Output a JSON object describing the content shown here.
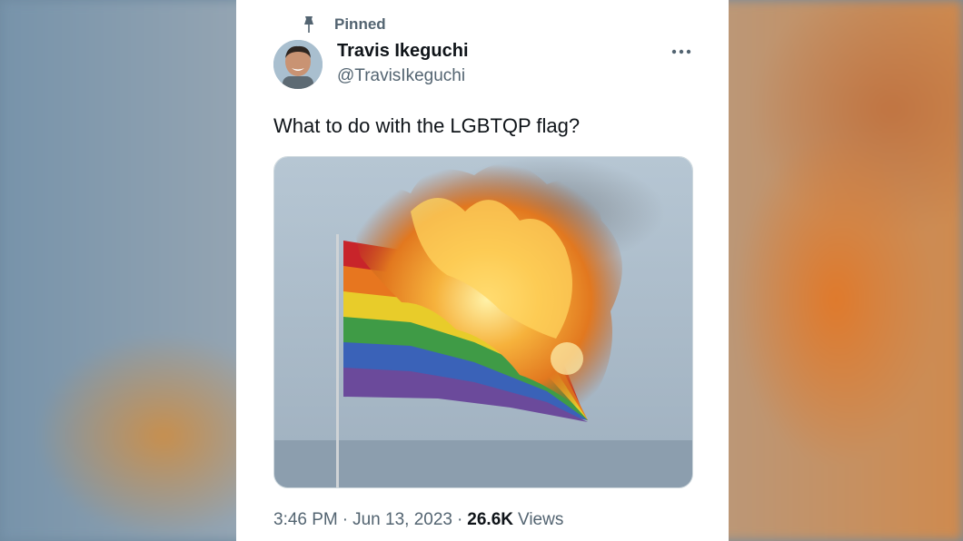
{
  "tweet": {
    "pinned_label": "Pinned",
    "author_name": "Travis Ikeguchi",
    "author_handle": "@TravisIkeguchi",
    "text": "What to do with the LGBTQP flag?",
    "time": "3:46 PM",
    "date": "Jun 13, 2023",
    "separator": "·",
    "views_count": "26.6K",
    "views_label": "Views"
  },
  "icons": {
    "pin": "pin-icon",
    "more": "more-horizontal-icon"
  },
  "colors": {
    "primary_text": "#0f1419",
    "secondary_text": "#536471",
    "border": "#cfd9de",
    "card_background": "#ffffff"
  }
}
